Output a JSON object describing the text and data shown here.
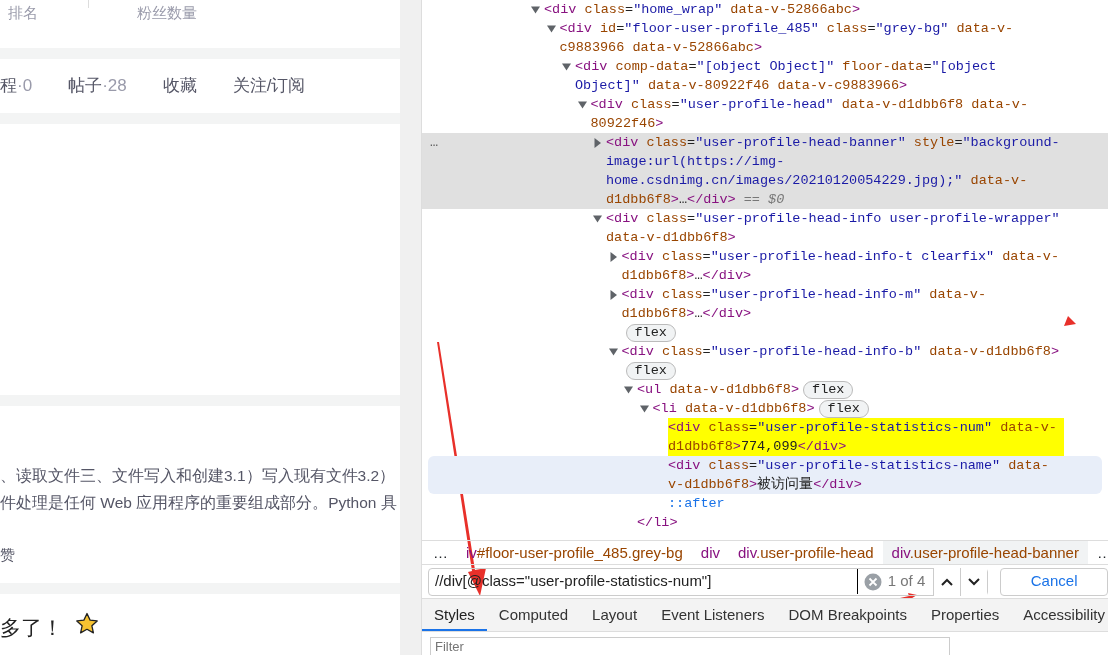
{
  "page": {
    "stats_labels": [
      "排名",
      "粉丝数量"
    ],
    "tabs": [
      {
        "label": "程",
        "count": "·0"
      },
      {
        "label": "帖子",
        "count": "·28"
      },
      {
        "label": "收藏"
      },
      {
        "label": "关注/订阅"
      }
    ],
    "article": {
      "lines": [
        "、读取文件三、文件写入和创建3.1）写入现有文件3.2）",
        "件处理是任何 Web 应用程序的重要组成部分。Python 具"
      ],
      "footer": "赞"
    },
    "comment": {
      "text": "多了！"
    }
  },
  "devtools": {
    "tree": [
      {
        "kind": "element",
        "expanded": true,
        "markup": "<div class=\"home_wrap\" data-v-52866abc>",
        "children": [
          {
            "kind": "element",
            "expanded": true,
            "markup": "<div id=\"floor-user-profile_485\" class=\"grey-bg\" data-v-c9883966 data-v-52866abc>",
            "children": [
              {
                "kind": "element",
                "expanded": true,
                "markup": "<div comp-data=\"[object Object]\" floor-data=\"[object Object]\" data-v-80922f46 data-v-c9883966>",
                "children": [
                  {
                    "kind": "element",
                    "expanded": true,
                    "markup": "<div class=\"user-profile-head\" data-v-d1dbb6f8 data-v-80922f46>",
                    "children": [
                      {
                        "kind": "element",
                        "expanded": false,
                        "selected": true,
                        "more_button": "…",
                        "markup": "<div class=\"user-profile-head-banner\" style=\"background-image:url(https://img-home.csdnimg.cn/images/20210120054229.jpg);\" data-v-d1dbb6f8>…</div>",
                        "suffix": "== $0"
                      },
                      {
                        "kind": "element",
                        "expanded": true,
                        "markup": "<div class=\"user-profile-head-info user-profile-wrapper\" data-v-d1dbb6f8>",
                        "children": [
                          {
                            "kind": "element",
                            "expanded": false,
                            "markup": "<div class=\"user-profile-head-info-t clearfix\" data-v-d1dbb6f8>…</div>"
                          },
                          {
                            "kind": "element",
                            "expanded": false,
                            "markup": "<div class=\"user-profile-head-info-m\" data-v-d1dbb6f8>…</div>",
                            "badge": "flex"
                          },
                          {
                            "kind": "element",
                            "expanded": true,
                            "markup": "<div class=\"user-profile-head-info-b\" data-v-d1dbb6f8>",
                            "badge": "flex",
                            "children": [
                              {
                                "kind": "element",
                                "expanded": true,
                                "markup": "<ul data-v-d1dbb6f8>",
                                "badge": "flex",
                                "children": [
                                  {
                                    "kind": "element",
                                    "expanded": true,
                                    "markup": "<li data-v-d1dbb6f8>",
                                    "badge": "flex",
                                    "children": [
                                      {
                                        "kind": "leaf",
                                        "match": true,
                                        "markup": "<div class=\"user-profile-statistics-num\" data-v-d1dbb6f8>774,099</div>"
                                      },
                                      {
                                        "kind": "leaf",
                                        "hovered": true,
                                        "markup": "<div class=\"user-profile-statistics-name\" data-v-d1dbb6f8>被访问量</div>"
                                      },
                                      {
                                        "kind": "pseudo",
                                        "markup": "::after"
                                      }
                                    ]
                                  },
                                  {
                                    "kind": "closing",
                                    "markup": "</li>"
                                  }
                                ]
                              }
                            ]
                          }
                        ]
                      }
                    ]
                  }
                ]
              }
            ]
          }
        ]
      }
    ],
    "breadcrumbs": [
      {
        "tag": "iv",
        "rest": "#floor-user-profile_485.grey-bg",
        "selected": false
      },
      {
        "tag": "div",
        "selected": false
      },
      {
        "tag": "div",
        "rest": ".user-profile-head",
        "selected": false
      },
      {
        "tag": "div",
        "rest": ".user-profile-head-banner",
        "selected": true
      }
    ],
    "breadcrumb_more": "…",
    "breadcrumb_overflow": "…",
    "search": {
      "value": "//div[@class=\"user-profile-statistics-num\"]",
      "match_count": "1 of 4"
    },
    "cancel_button": "Cancel",
    "tabs": [
      {
        "label": "Styles",
        "selected": true
      },
      {
        "label": "Computed",
        "selected": false
      },
      {
        "label": "Layout",
        "selected": false
      },
      {
        "label": "Event Listeners",
        "selected": false
      },
      {
        "label": "DOM Breakpoints",
        "selected": false
      },
      {
        "label": "Properties",
        "selected": false
      },
      {
        "label": "Accessibility",
        "selected": false
      }
    ],
    "filter": {
      "placeholder": "Filter"
    }
  }
}
